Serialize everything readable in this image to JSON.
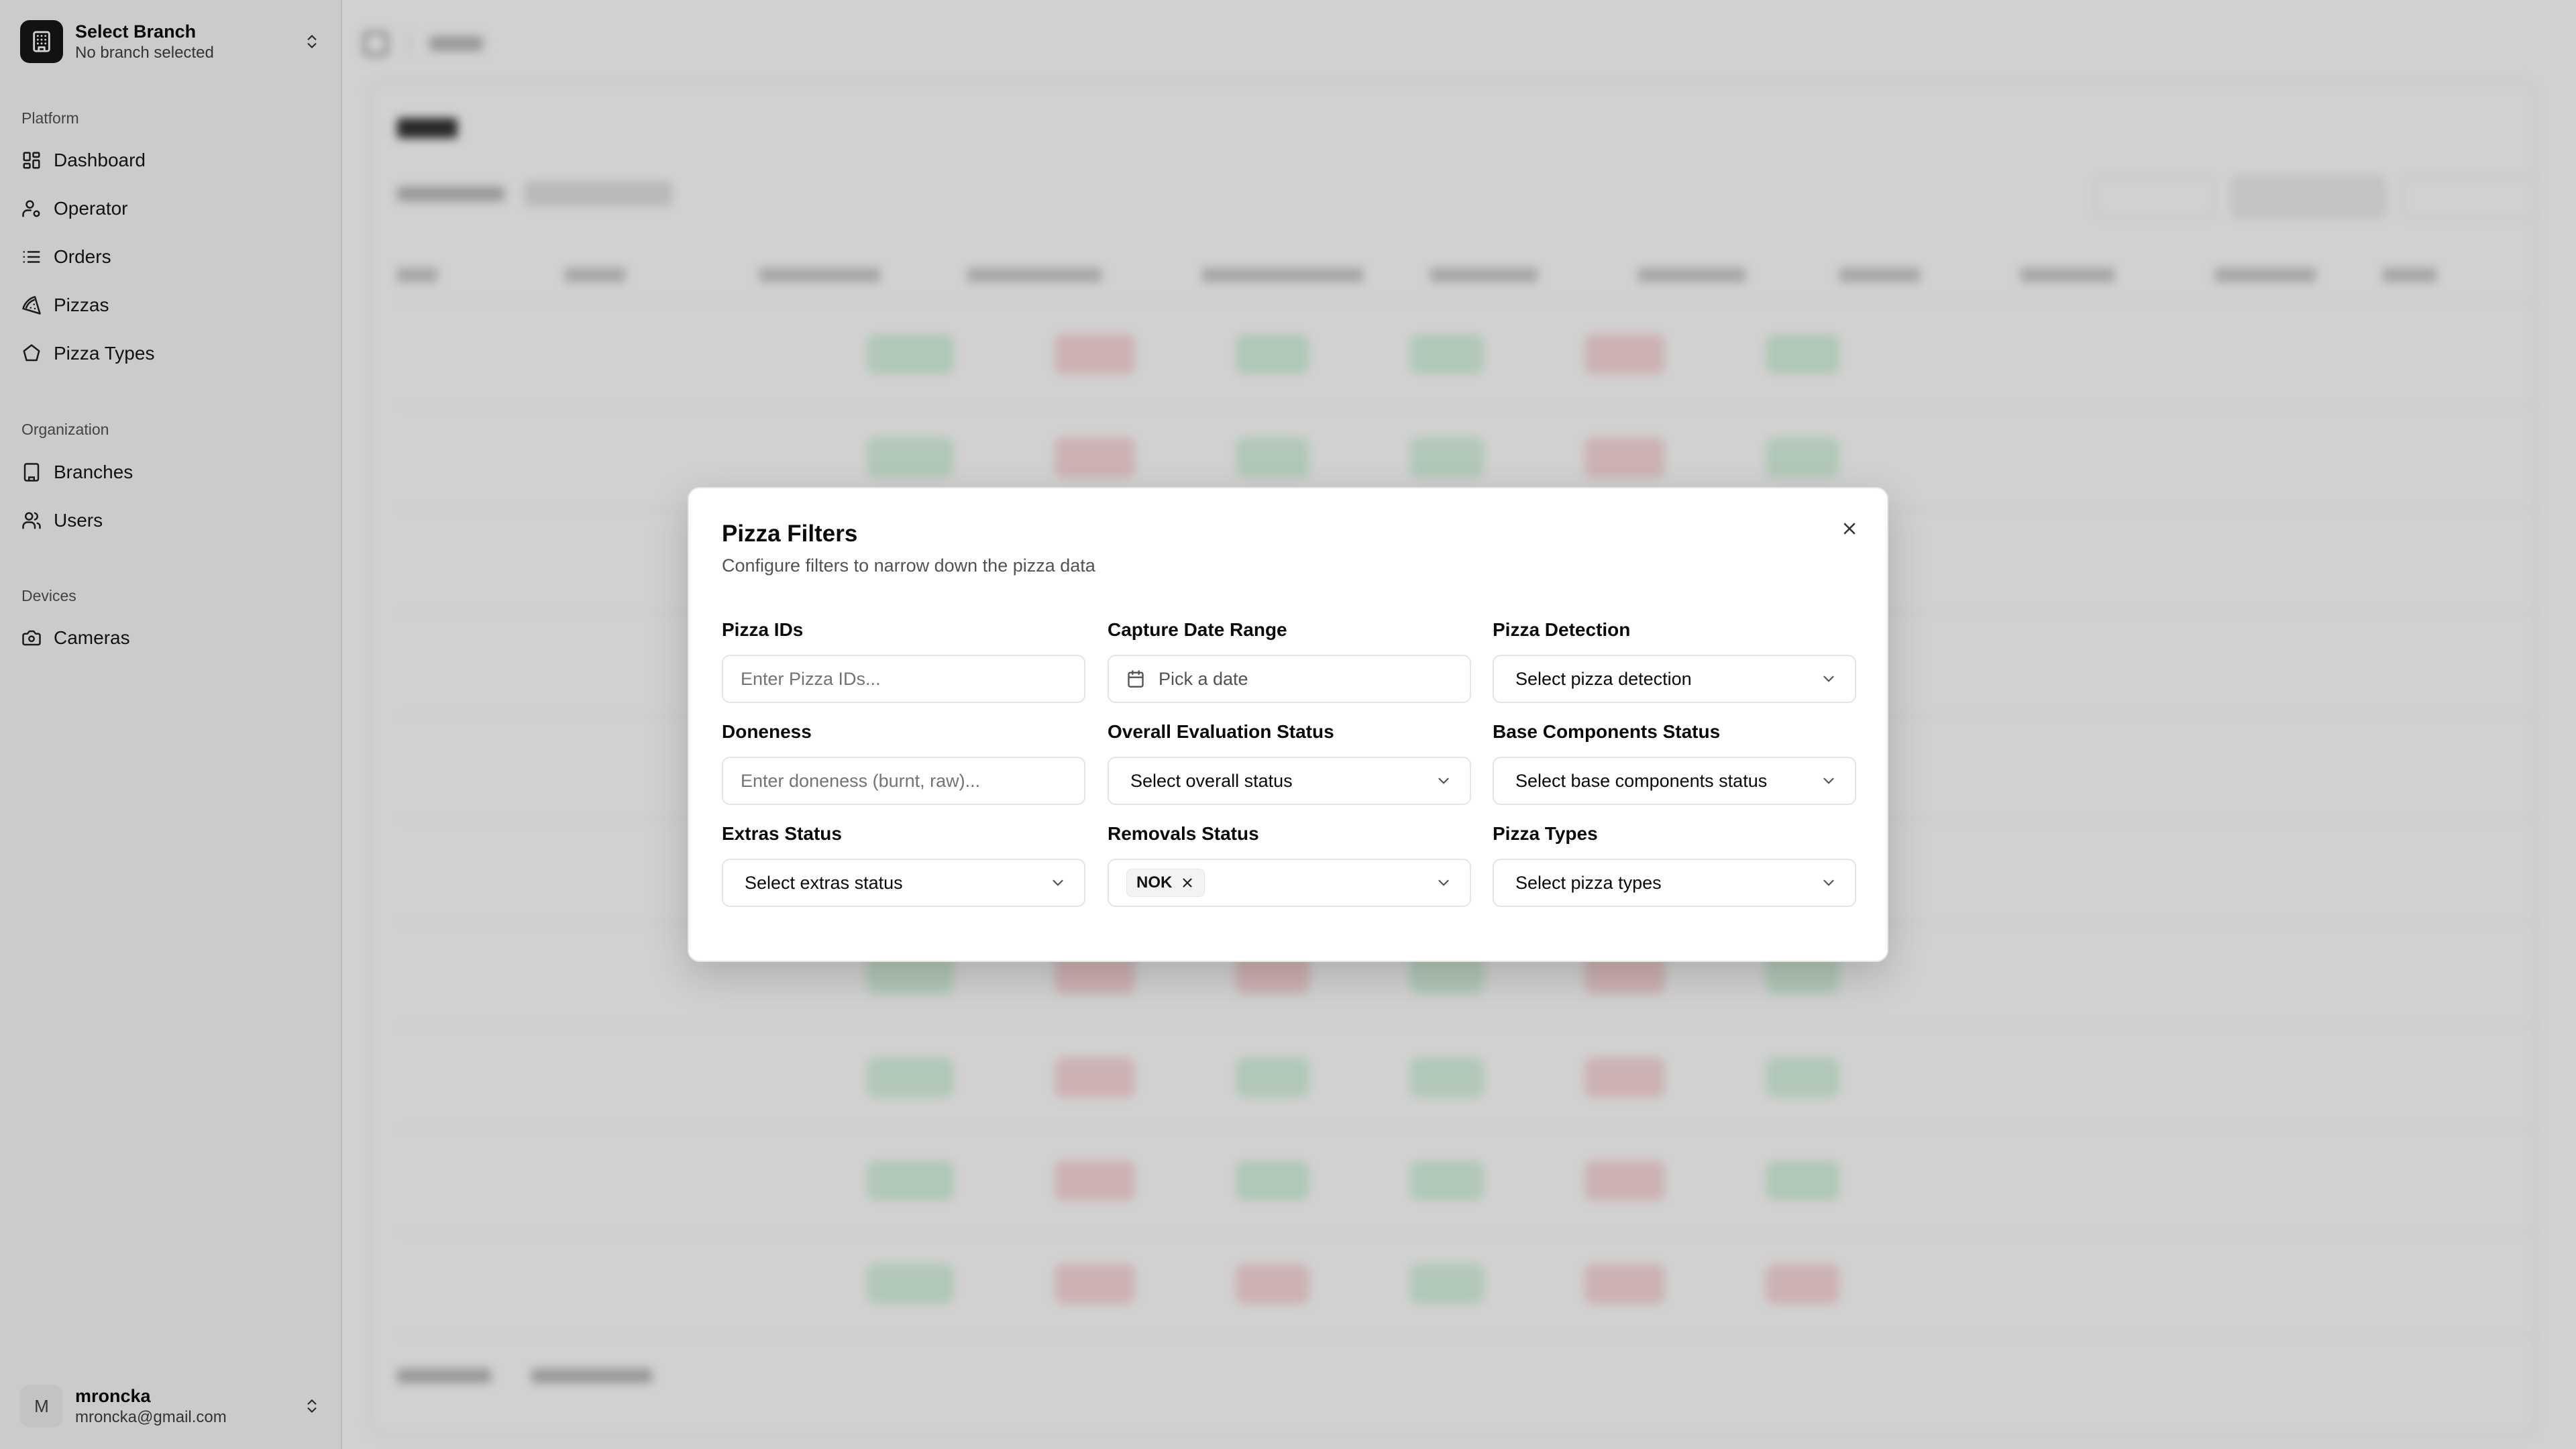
{
  "sidebar": {
    "branch_title": "Select Branch",
    "branch_subtitle": "No branch selected",
    "groups": {
      "platform": "Platform",
      "organization": "Organization",
      "devices": "Devices"
    },
    "items": {
      "dashboard": "Dashboard",
      "operator": "Operator",
      "orders": "Orders",
      "pizzas": "Pizzas",
      "pizza_types": "Pizza Types",
      "branches": "Branches",
      "users": "Users",
      "cameras": "Cameras"
    },
    "user": {
      "initial": "M",
      "name": "mroncka",
      "email": "mroncka@gmail.com"
    }
  },
  "dialog": {
    "title": "Pizza Filters",
    "description": "Configure filters to narrow down the pizza data",
    "fields": {
      "pizza_ids": {
        "label": "Pizza IDs",
        "placeholder": "Enter Pizza IDs..."
      },
      "capture_date": {
        "label": "Capture Date Range",
        "placeholder": "Pick a date"
      },
      "pizza_detection": {
        "label": "Pizza Detection",
        "placeholder": "Select pizza detection"
      },
      "doneness": {
        "label": "Doneness",
        "placeholder": "Enter doneness (burnt, raw)..."
      },
      "overall_status": {
        "label": "Overall Evaluation Status",
        "placeholder": "Select overall status"
      },
      "base_status": {
        "label": "Base Components Status",
        "placeholder": "Select base components status"
      },
      "extras_status": {
        "label": "Extras Status",
        "placeholder": "Select extras status"
      },
      "removals_status": {
        "label": "Removals Status",
        "selected_tag": "NOK"
      },
      "pizza_types": {
        "label": "Pizza Types",
        "placeholder": "Select pizza types"
      }
    }
  }
}
